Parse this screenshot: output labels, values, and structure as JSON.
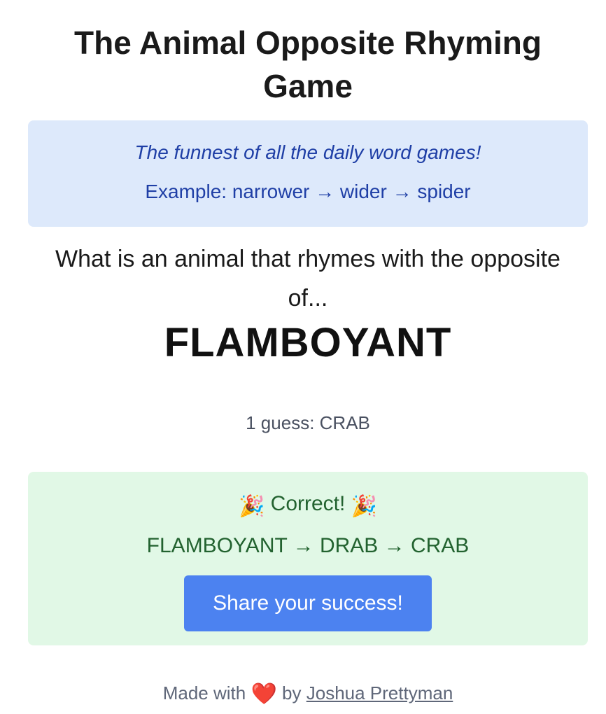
{
  "header": {
    "title": "The Animal Opposite Rhyming Game"
  },
  "intro": {
    "tagline": "The funnest of all the daily word games!",
    "example": "Example: narrower → wider → spider"
  },
  "puzzle": {
    "question": "What is an animal that rhymes with the opposite of...",
    "target_word": "FLAMBOYANT"
  },
  "guesses": {
    "summary": "1 guess: CRAB"
  },
  "result": {
    "left_emoji": "🎉",
    "status": "Correct!",
    "right_emoji": "🎉",
    "chain": "FLAMBOYANT → DRAB → CRAB",
    "share_label": "Share your success!"
  },
  "footer": {
    "made_with": "Made with",
    "heart_icon": "❤️",
    "by": "by",
    "author": "Joshua Prettyman"
  },
  "colors": {
    "intro_background": "#dde9fb",
    "intro_text": "#1f3fa6",
    "result_background": "#e1f8e6",
    "result_text": "#22622f",
    "share_button": "#4c82f0",
    "footer_text": "#5f6779"
  }
}
